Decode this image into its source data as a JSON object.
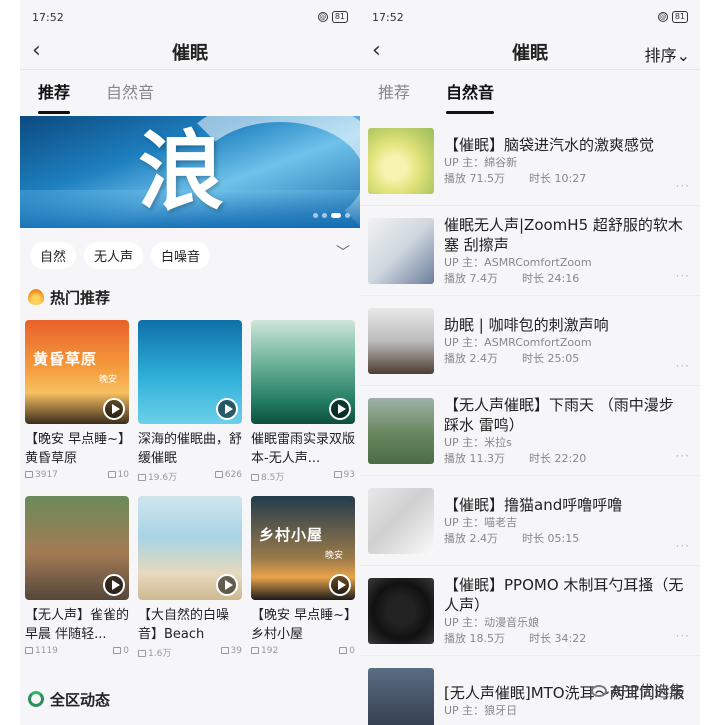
{
  "left": {
    "status": {
      "time": "17:52",
      "signal": "ıll",
      "battery": "81"
    },
    "nav": {
      "back": "‹",
      "title": "催眠"
    },
    "tabs": [
      "推荐",
      "自然音"
    ],
    "banner": {
      "char": "浪"
    },
    "chips": [
      "自然",
      "无人声",
      "白噪音"
    ],
    "hot_title": "热门推荐",
    "cards": [
      {
        "thumb_text": "黄昏草原",
        "thumb_sub": "晚安",
        "title": "【晚安 早点睡~】黄昏草原",
        "plays": "3917",
        "comments": "10"
      },
      {
        "thumb_text": "",
        "thumb_sub": "",
        "title": "深海的催眠曲，舒缓催眠",
        "plays": "19.6万",
        "comments": "626"
      },
      {
        "thumb_text": "",
        "thumb_sub": "",
        "title": "催眠雷雨实录双版本-无人声...",
        "plays": "8.5万",
        "comments": "93"
      },
      {
        "thumb_text": "",
        "thumb_sub": "",
        "title": "【无人声】雀雀的早晨 伴随轻...",
        "plays": "1119",
        "comments": "0"
      },
      {
        "thumb_text": "",
        "thumb_sub": "",
        "title": "【大自然的白噪音】Beach and...",
        "plays": "1.6万",
        "comments": "39"
      },
      {
        "thumb_text": "乡村小屋",
        "thumb_sub": "晚安",
        "title": "【晚安 早点睡~】乡村小屋",
        "plays": "192",
        "comments": "0"
      }
    ],
    "zone_title": "全区动态"
  },
  "right": {
    "status": {
      "time": "17:52",
      "signal": "ıll",
      "battery": "81"
    },
    "nav": {
      "back": "‹",
      "title": "催眠",
      "sort": "排序⌄"
    },
    "tabs": [
      "推荐",
      "自然音"
    ],
    "items": [
      {
        "title": "【催眠】脑袋进汽水的激爽感觉",
        "up": "UP 主：綿谷新",
        "plays": "播放 71.5万",
        "duration": "时长 10:27"
      },
      {
        "title": "催眠无人声|ZoomH5 超舒服的软木塞 刮擦声",
        "up": "UP 主：ASMRComfortZoom",
        "plays": "播放 7.4万",
        "duration": "时长 24:16"
      },
      {
        "title": "助眠 | 咖啡包的刺激声响",
        "up": "UP 主：ASMRComfortZoom",
        "plays": "播放 2.4万",
        "duration": "时长 25:05"
      },
      {
        "title": "【无人声催眠】下雨天 （雨中漫步 踩水 雷鸣）",
        "up": "UP 主：米拉s",
        "plays": "播放 11.3万",
        "duration": "时长 22:20"
      },
      {
        "title": "【催眠】撸猫and呼噜呼噜",
        "up": "UP 主：喵老吉",
        "plays": "播放 2.4万",
        "duration": "时长 05:15"
      },
      {
        "title": "【催眠】PPOMO 木制耳勺耳搔（无人声）",
        "up": "UP 主：动漫音乐娘",
        "plays": "播放 18.5万",
        "duration": "时长 34:22"
      },
      {
        "title": "[无人声催眠]MTO洗耳～两耳同时版",
        "up": "UP 主：狼牙日",
        "plays": "",
        "duration": ""
      }
    ],
    "more": "···",
    "watermark": "APP优选集"
  }
}
